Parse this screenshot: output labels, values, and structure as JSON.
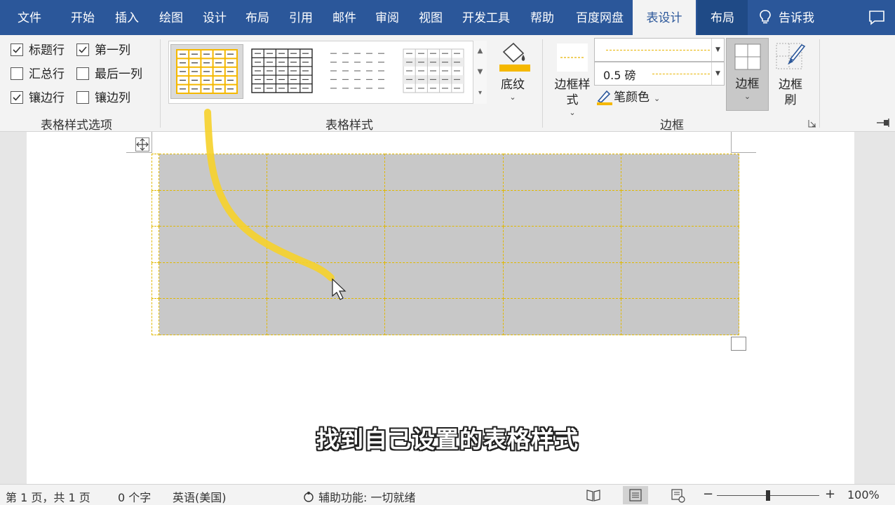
{
  "menu": {
    "tabs": [
      "文件",
      "开始",
      "插入",
      "绘图",
      "设计",
      "布局",
      "引用",
      "邮件",
      "审阅",
      "视图",
      "开发工具",
      "帮助",
      "百度网盘",
      "表设计",
      "布局"
    ],
    "active_index": 13,
    "tell_me": "告诉我"
  },
  "ribbon": {
    "style_options": {
      "checkboxes": [
        {
          "label": "标题行",
          "checked": true
        },
        {
          "label": "第一列",
          "checked": true
        },
        {
          "label": "汇总行",
          "checked": false
        },
        {
          "label": "最后一列",
          "checked": false
        },
        {
          "label": "镶边行",
          "checked": true
        },
        {
          "label": "镶边列",
          "checked": false
        }
      ],
      "group_label": "表格样式选项"
    },
    "table_styles": {
      "group_label": "表格样式",
      "shading_label": "底纹"
    },
    "borders": {
      "border_styles_label": "边框样式",
      "weight_value": "0.5 磅",
      "pen_color_label": "笔颜色",
      "borders_label": "边框",
      "border_painter_label": "边框刷",
      "group_label": "边框"
    },
    "colors": {
      "accent": "#2b579a",
      "highlight": "#f5b800"
    }
  },
  "document": {
    "subtitle": "找到自己设置的表格样式",
    "table": {
      "rows": 5,
      "cols": 6
    }
  },
  "status": {
    "page_info": "第 1 页，共 1 页",
    "word_count": "0 个字",
    "language": "英语(美国)",
    "accessibility": "辅助功能: 一切就绪",
    "zoom": "100%",
    "zoom_level": 0.5
  }
}
